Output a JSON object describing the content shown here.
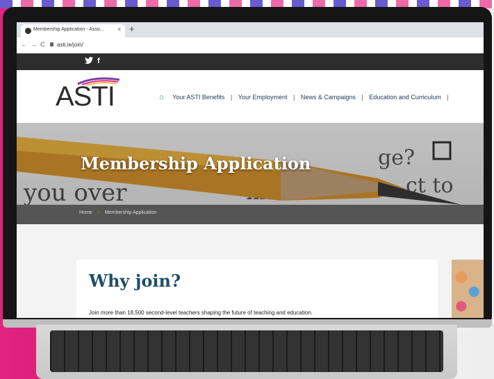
{
  "browser": {
    "tab_title": "Membership Application - Asso...",
    "tab_close": "×",
    "new_tab": "+",
    "url": "asti.ie/join/",
    "back": "←",
    "forward": "→",
    "reload": "C"
  },
  "social": {
    "twitter": "🐦",
    "facebook": "f"
  },
  "header": {
    "logo": "ASTI",
    "nav_items": [
      {
        "label": "Your ASTI Benefits"
      },
      {
        "label": "Your Employment"
      },
      {
        "label": "News & Campaigns"
      },
      {
        "label": "Education and Curriculum"
      }
    ],
    "separator": "|",
    "home_icon": "⌂"
  },
  "hero": {
    "title": "Membership Application",
    "bg_words": "you over   ment is   ge?   ct to"
  },
  "breadcrumb": {
    "home": "Home",
    "arrow": "›",
    "current": "Membership Application"
  },
  "main": {
    "heading": "Why join?",
    "text": "Join more than 18,500 second-level teachers shaping the future of teaching and education."
  },
  "colors": {
    "accent": "#e0237e",
    "heading": "#1f4f66",
    "home_icon": "#1e7f6e"
  }
}
